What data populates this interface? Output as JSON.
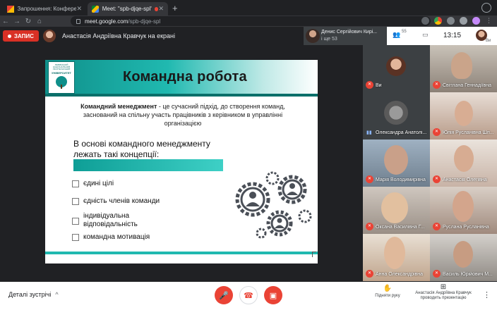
{
  "browser": {
    "tabs": [
      {
        "title": "Запрошення: Конференція \"С",
        "active": false
      },
      {
        "title": "Meet: \"spb-djqe-spl\"",
        "active": true
      },
      {
        "title": "",
        "active": false
      }
    ],
    "url_host": "meet.google.com",
    "url_path": "/spb-djqe-spl"
  },
  "meet_bar": {
    "record_label": "ЗАПИС",
    "presenting_label": "Анастасія Андріївна Кравчук на екрані",
    "speaker_name": "Денис Сергійович Кирі...",
    "speaker_more": "і ще 53",
    "people_count": "55",
    "clock": "13:15",
    "me_label": "Ви"
  },
  "slide": {
    "logo_top": "ЛЬВІВСЬКИЙ НАЦІОНАЛЬНИЙ ЛІСОТЕХНІЧНИЙ",
    "logo_name": "УНІВЕРСИТЕТ",
    "title": "Командна робота",
    "intro_bold": "Командний менеджмент",
    "intro_rest": " - це сучасний підхід, до створення команд, заснований на спільну участь працівників з керівником в управлінні організацією",
    "basis_line1": "В основі командного менеджменту",
    "basis_line2": "лежать такі концепції:",
    "items": [
      "єдині цілі",
      "єдність членів команди",
      "індивідуальна відповідальність",
      "командна мотивація"
    ]
  },
  "participants": [
    {
      "name": "Ви",
      "muted": true
    },
    {
      "name": "Світлана Геннадіївна",
      "muted": true
    },
    {
      "name": "Олександра Анатолі...",
      "muted": false
    },
    {
      "name": "Юлія Русланівна Шп...",
      "muted": true
    },
    {
      "name": "Марія Володимирівна",
      "muted": true
    },
    {
      "name": "Анастасія Олегівна",
      "muted": true
    },
    {
      "name": "Оксана Василівна Г...",
      "muted": true
    },
    {
      "name": "Руслана Русланівна",
      "muted": true
    },
    {
      "name": "Анна Олександрівна",
      "muted": true
    },
    {
      "name": "Василь Юрійович М...",
      "muted": true
    }
  ],
  "bottom_bar": {
    "details_label": "Деталі зустрічі",
    "raise_label": "Підняти руку",
    "present_line1": "Анастасія Андріївна Кравчук",
    "present_line2": "проводить презентацію"
  }
}
